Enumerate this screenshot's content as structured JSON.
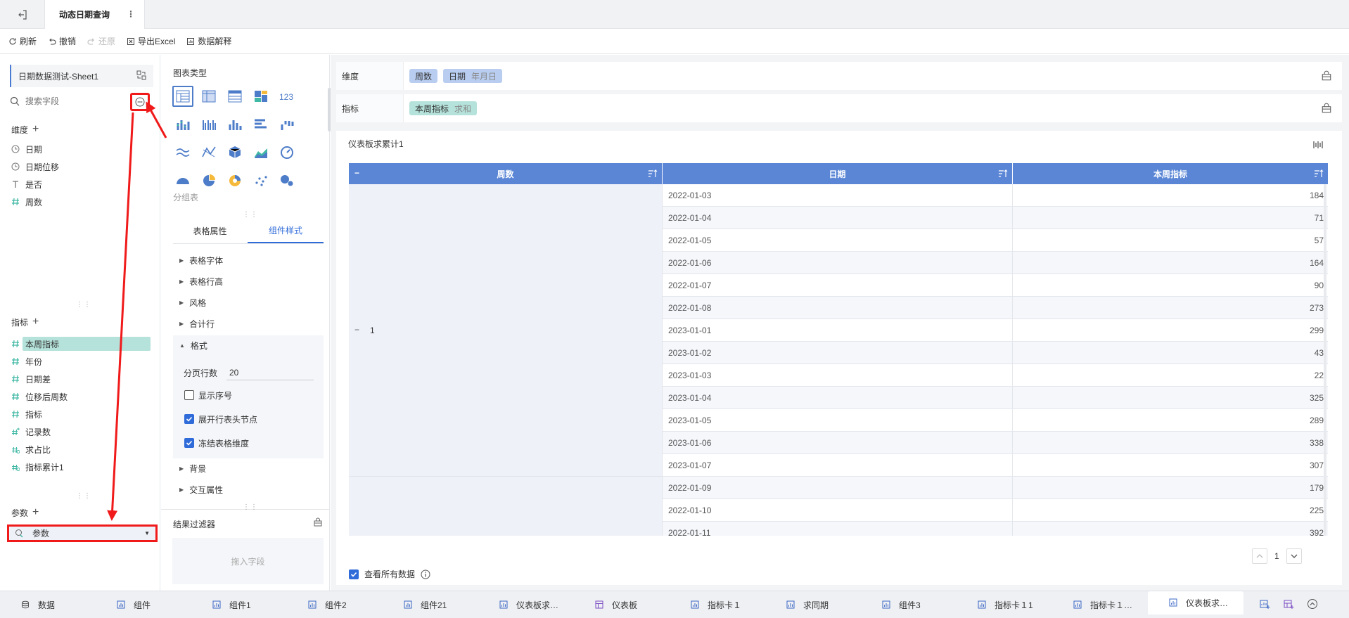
{
  "title_bar": {
    "active_tab": "动态日期查询"
  },
  "toolbar": {
    "refresh": "刷新",
    "undo": "撤销",
    "redo": "还原",
    "export": "导出Excel",
    "explain": "数据解释"
  },
  "left": {
    "dataset": "日期数据测试-Sheet1",
    "search_placeholder": "搜索字段",
    "dimensions_title": "维度",
    "dimensions": [
      {
        "label": "日期",
        "icon": "clock-icon"
      },
      {
        "label": "日期位移",
        "icon": "clock-icon"
      },
      {
        "label": "是否",
        "icon": "text-type-icon"
      },
      {
        "label": "周数",
        "icon": "hash-icon"
      }
    ],
    "measures_title": "指标",
    "measures": [
      {
        "label": "本周指标",
        "icon": "hash-icon"
      },
      {
        "label": "年份",
        "icon": "hash-icon"
      },
      {
        "label": "日期差",
        "icon": "hash-icon"
      },
      {
        "label": "位移后周数",
        "icon": "hash-icon"
      },
      {
        "label": "指标",
        "icon": "hash-icon"
      },
      {
        "label": "记录数",
        "icon": "hash-plus-icon"
      },
      {
        "label": "求占比",
        "icon": "hash-calc-icon"
      },
      {
        "label": "指标累计1",
        "icon": "hash-calc-icon"
      }
    ],
    "params_title": "参数",
    "param_item": "参数"
  },
  "middle": {
    "chart_type_title": "图表类型",
    "chart_type_caption": "分组表",
    "sub_tabs": [
      "表格属性",
      "组件样式"
    ],
    "sections": [
      "表格字体",
      "表格行高",
      "风格",
      "合计行"
    ],
    "format_title": "格式",
    "rows_per_page_label": "分页行数",
    "rows_per_page_value": "20",
    "checkboxes": [
      {
        "label": "显示序号",
        "checked": false
      },
      {
        "label": "展开行表头节点",
        "checked": true
      },
      {
        "label": "冻结表格维度",
        "checked": true
      }
    ],
    "sections_after": [
      "背景",
      "交互属性"
    ],
    "result_filter_title": "结果过滤器",
    "drop_placeholder": "拖入字段"
  },
  "right": {
    "dimension_shelf_label": "维度",
    "dimension_pills": [
      {
        "label": "周数",
        "sub": ""
      },
      {
        "label": "日期",
        "sub": "年月日"
      }
    ],
    "measure_shelf_label": "指标",
    "measure_pills": [
      {
        "label": "本周指标",
        "sub": "求和"
      }
    ],
    "card_title": "仪表板求累计1",
    "table": {
      "headers": [
        "周数",
        "日期",
        "本周指标"
      ],
      "group1_label": "1",
      "rows": [
        {
          "date": "2022-01-03",
          "value": "184"
        },
        {
          "date": "2022-01-04",
          "value": "71"
        },
        {
          "date": "2022-01-05",
          "value": "57"
        },
        {
          "date": "2022-01-06",
          "value": "164"
        },
        {
          "date": "2022-01-07",
          "value": "90"
        },
        {
          "date": "2022-01-08",
          "value": "273"
        },
        {
          "date": "2023-01-01",
          "value": "299"
        },
        {
          "date": "2023-01-02",
          "value": "43"
        },
        {
          "date": "2023-01-03",
          "value": "22"
        },
        {
          "date": "2023-01-04",
          "value": "325"
        },
        {
          "date": "2023-01-05",
          "value": "289"
        },
        {
          "date": "2023-01-06",
          "value": "338"
        },
        {
          "date": "2023-01-07",
          "value": "307"
        },
        {
          "date": "2022-01-09",
          "value": "179"
        },
        {
          "date": "2022-01-10",
          "value": "225"
        },
        {
          "date": "2022-01-11",
          "value": "392"
        }
      ]
    },
    "page_number": "1",
    "view_all_label": "查看所有数据"
  },
  "bottom_tabs": [
    {
      "label": "数据",
      "icon": "database-icon"
    },
    {
      "label": "组件",
      "icon": "chart-icon"
    },
    {
      "label": "组件1",
      "icon": "chart-icon"
    },
    {
      "label": "组件2",
      "icon": "chart-icon"
    },
    {
      "label": "组件21",
      "icon": "chart-icon"
    },
    {
      "label": "仪表板求…",
      "icon": "chart-icon"
    },
    {
      "label": "仪表板",
      "icon": "dashboard-icon"
    },
    {
      "label": "指标卡１",
      "icon": "chart-icon"
    },
    {
      "label": "求同期",
      "icon": "chart-icon"
    },
    {
      "label": "组件3",
      "icon": "chart-icon"
    },
    {
      "label": "指标卡１1",
      "icon": "chart-icon"
    },
    {
      "label": "指标卡１…",
      "icon": "chart-icon"
    },
    {
      "label": "仪表板求…",
      "icon": "chart-icon"
    }
  ],
  "colors": {
    "accent": "#5b86d6",
    "measure": "#3fb8a5",
    "highlight": "#f01a1a"
  }
}
